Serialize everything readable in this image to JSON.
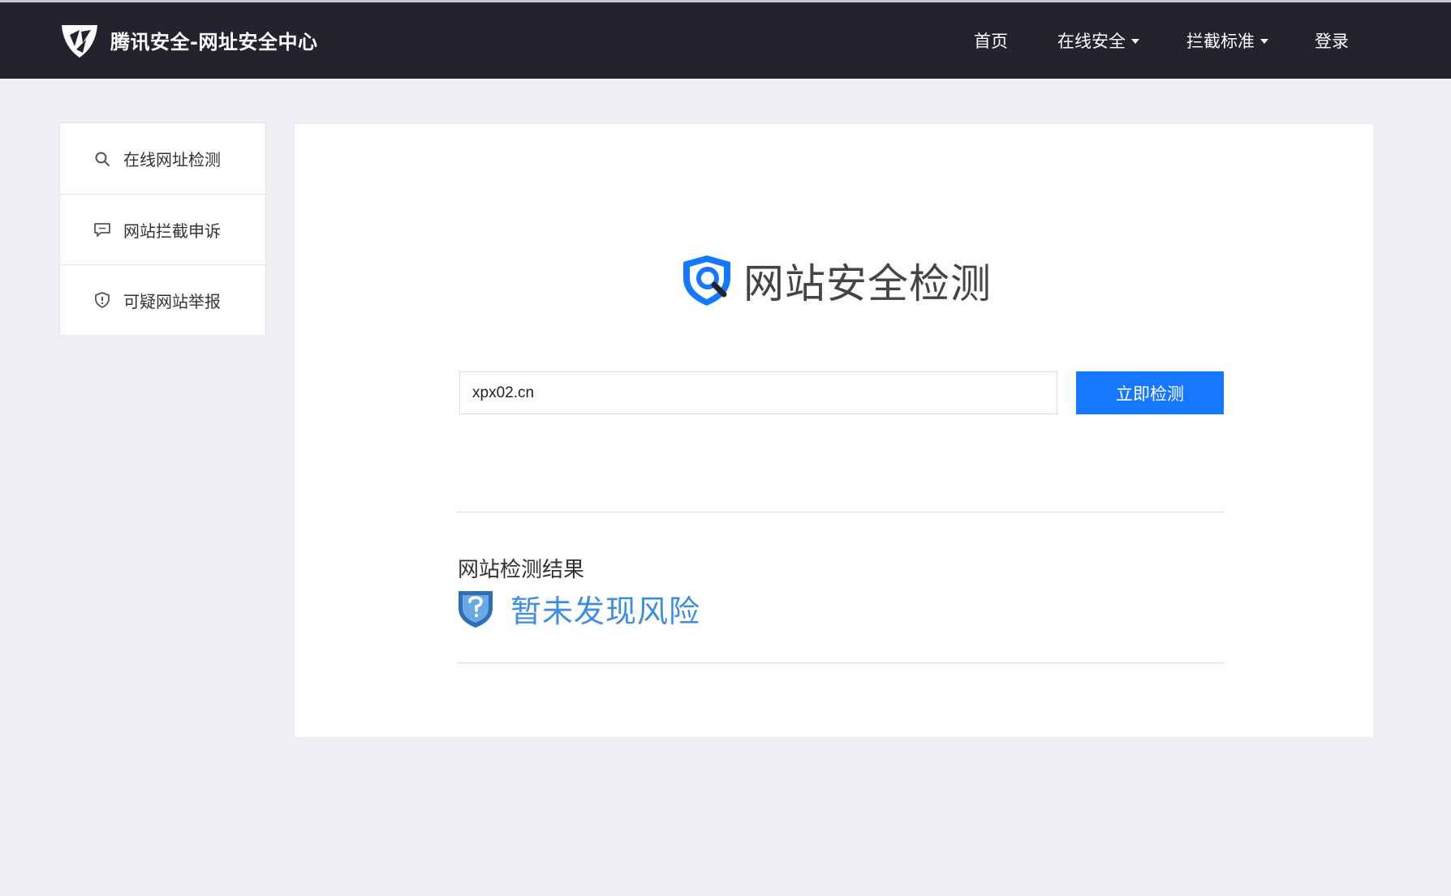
{
  "header": {
    "brand": "腾讯安全-网址安全中心",
    "nav": [
      {
        "label": "首页",
        "dropdown": false
      },
      {
        "label": "在线安全",
        "dropdown": true
      },
      {
        "label": "拦截标准",
        "dropdown": true
      },
      {
        "label": "登录",
        "dropdown": false
      }
    ]
  },
  "sidebar": {
    "items": [
      {
        "label": "在线网址检测",
        "icon": "search-icon"
      },
      {
        "label": "网站拦截申诉",
        "icon": "comment-icon"
      },
      {
        "label": "可疑网站举报",
        "icon": "shield-alert-icon"
      }
    ]
  },
  "main": {
    "heading": "网站安全检测",
    "search": {
      "value": "xpx02.cn",
      "placeholder": ""
    },
    "button_label": "立即检测",
    "result_title": "网站检测结果",
    "result_status": "暂未发现风险"
  },
  "colors": {
    "header_bg": "#22232f",
    "accent": "#1677ff",
    "result_text": "#3d8ee0"
  }
}
